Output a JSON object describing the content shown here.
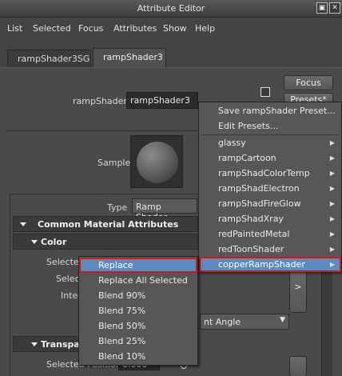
{
  "window": {
    "title": "Attribute Editor"
  },
  "menubar": [
    "List",
    "Selected",
    "Focus",
    "Attributes",
    "Show",
    "Help"
  ],
  "tabs": [
    {
      "label": "rampShader3SG",
      "active": false
    },
    {
      "label": "rampShader3",
      "active": true
    }
  ],
  "header": {
    "node_label": "rampShader:",
    "node_value": "rampShader3",
    "focus_label": "Focus",
    "presets_label": "Presets*"
  },
  "sample": {
    "label": "Sample"
  },
  "type_row": {
    "label": "Type",
    "value": "Ramp Shader"
  },
  "sections": {
    "common": "Common Material Attributes",
    "color": "Color",
    "transparency": "Transpar"
  },
  "color_rows": {
    "selected": "Selected",
    "selec": "Selec",
    "inte": "Inte",
    "interp_value": "nt Angle",
    "more_btn": ">"
  },
  "transparency_rows": {
    "selected_position": "Selected Position",
    "value": "0.000"
  },
  "presets_menu": {
    "items": [
      {
        "label": "Save rampShader Preset...",
        "submenu": false
      },
      {
        "label": "Edit Presets...",
        "submenu": false
      },
      {
        "label": "glassy",
        "submenu": true
      },
      {
        "label": "rampCartoon",
        "submenu": true
      },
      {
        "label": "rampShadColorTemp",
        "submenu": true
      },
      {
        "label": "rampShadElectron",
        "submenu": true
      },
      {
        "label": "rampShadFireGlow",
        "submenu": true
      },
      {
        "label": "rampShadXray",
        "submenu": true
      },
      {
        "label": "redPaintedMetal",
        "submenu": true
      },
      {
        "label": "redToonShader",
        "submenu": true
      },
      {
        "label": "copperRampShader",
        "submenu": true,
        "highlighted": true
      }
    ]
  },
  "sub_menu": {
    "items": [
      {
        "label": "Replace",
        "highlighted": true
      },
      {
        "label": "Replace All Selected"
      },
      {
        "label": "Blend 90%"
      },
      {
        "label": "Blend 75%"
      },
      {
        "label": "Blend 50%"
      },
      {
        "label": "Blend 25%"
      },
      {
        "label": "Blend 10%"
      }
    ]
  },
  "colors": {
    "highlight": "#5b8bbf",
    "highlight_border": "#d01919",
    "panel_bg": "#4a4a4a"
  }
}
